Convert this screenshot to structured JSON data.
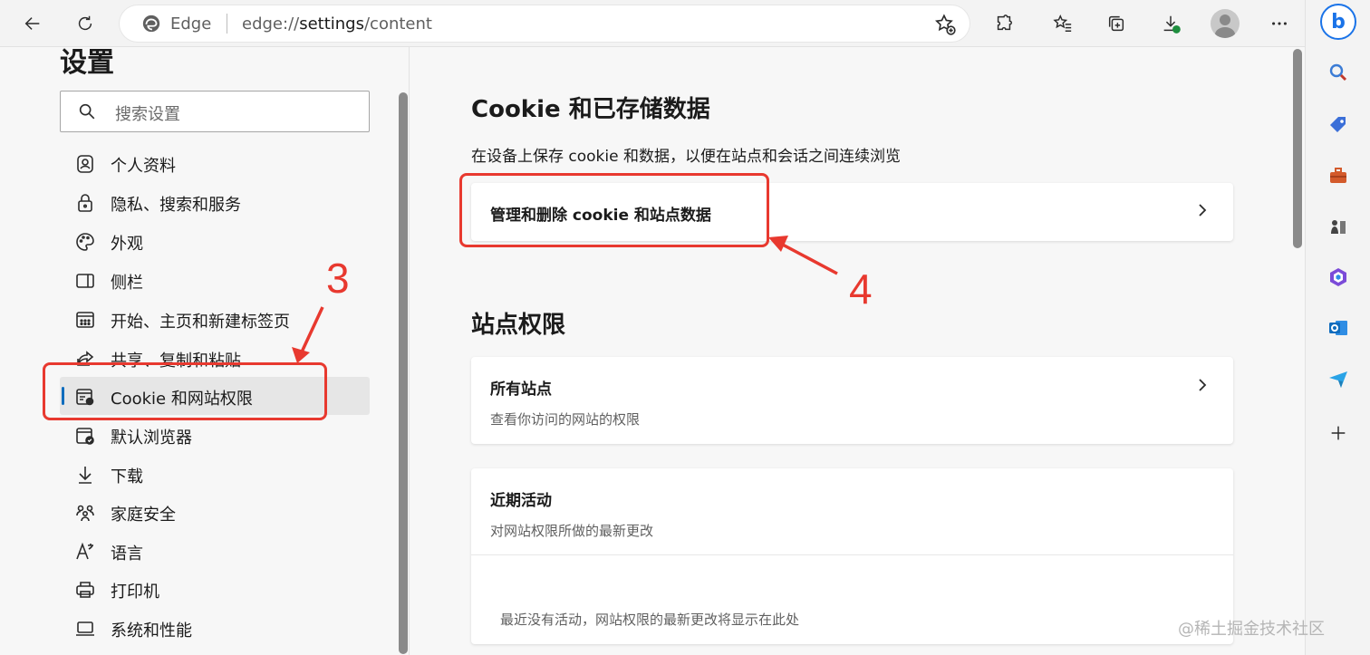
{
  "browser": {
    "site_label": "Edge",
    "url_prefix": "edge://",
    "url_host": "settings",
    "url_path": "/content"
  },
  "sidebar_nav": {
    "title": "设置",
    "search_placeholder": "搜索设置",
    "items": [
      {
        "label": "个人资料",
        "icon": "profile-icon"
      },
      {
        "label": "隐私、搜索和服务",
        "icon": "lock-icon"
      },
      {
        "label": "外观",
        "icon": "palette-icon"
      },
      {
        "label": "侧栏",
        "icon": "sidebar-icon"
      },
      {
        "label": "开始、主页和新建标签页",
        "icon": "home-grid-icon"
      },
      {
        "label": "共享、复制和粘贴",
        "icon": "share-icon"
      },
      {
        "label": "Cookie 和网站权限",
        "icon": "cookie-settings-icon",
        "active": true
      },
      {
        "label": "默认浏览器",
        "icon": "default-browser-icon"
      },
      {
        "label": "下载",
        "icon": "download-icon"
      },
      {
        "label": "家庭安全",
        "icon": "family-icon"
      },
      {
        "label": "语言",
        "icon": "language-icon"
      },
      {
        "label": "打印机",
        "icon": "printer-icon"
      },
      {
        "label": "系统和性能",
        "icon": "laptop-icon"
      }
    ]
  },
  "main": {
    "cookie_section": {
      "heading": "Cookie 和已存储数据",
      "description": "在设备上保存 cookie 和数据，以便在站点和会话之间连续浏览",
      "manage_card_label": "管理和删除 cookie 和站点数据"
    },
    "permissions_section": {
      "heading": "站点权限",
      "all_sites": {
        "title": "所有站点",
        "subtitle": "查看你访问的网站的权限"
      },
      "recent": {
        "title": "近期活动",
        "subtitle": "对网站权限所做的最新更改",
        "empty": "最近没有活动，网站权限的最新更改将显示在此处"
      }
    }
  },
  "annotations": {
    "step3": "3",
    "step4": "4",
    "color": "#e8392f"
  },
  "watermark": "@稀土掘金技术社区"
}
